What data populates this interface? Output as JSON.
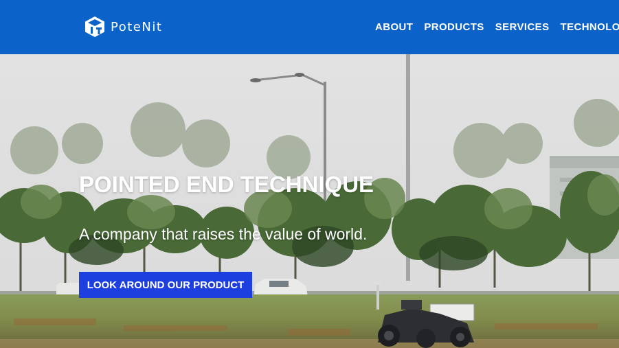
{
  "header": {
    "logo_text": "PoteNit",
    "nav": [
      "ABOUT",
      "PRODUCTS",
      "SERVICES",
      "TECHNOLOGY"
    ]
  },
  "hero": {
    "title": "POINTED END TECHNIQUE",
    "subtitle": "A company that raises the value of world.",
    "cta_label": "LOOK AROUND OUR PRODUCT"
  },
  "colors": {
    "header_bg": "#0b63c9",
    "cta_bg": "#1d3fe0"
  },
  "icons": [
    "potenit-logo-icon"
  ]
}
